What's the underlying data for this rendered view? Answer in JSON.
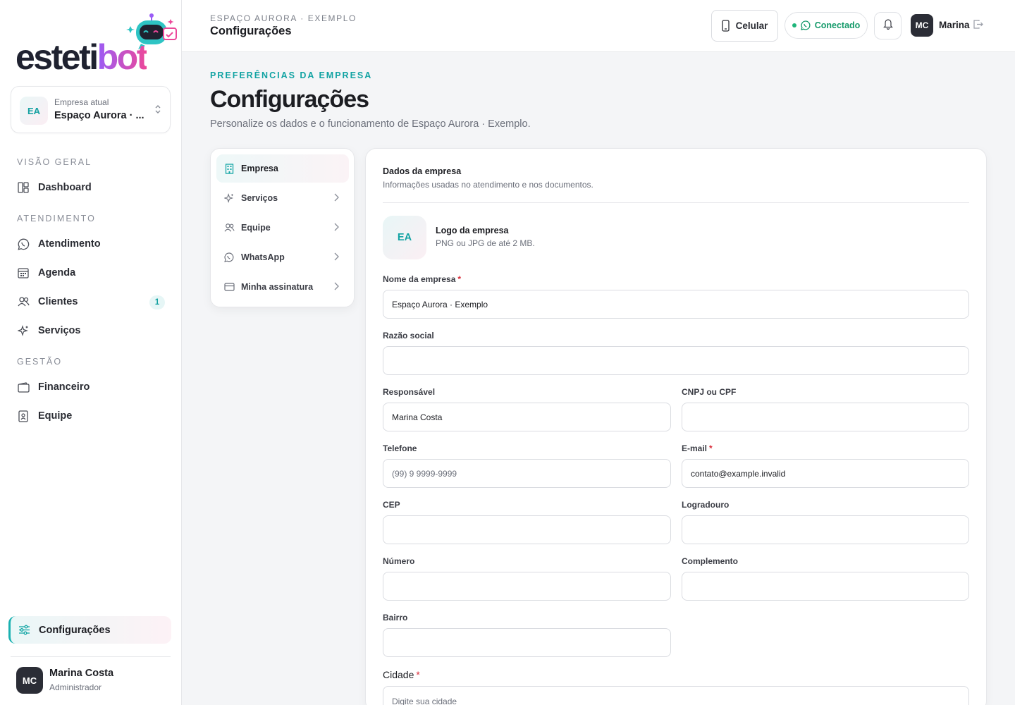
{
  "brand": {
    "logo_text_1": "esteti",
    "logo_text_2": "bot"
  },
  "sidebar": {
    "company_card": {
      "initials": "EA",
      "label": "Empresa atual",
      "name": "Espaço Aurora · ..."
    },
    "sections": [
      {
        "title": "VISÃO GERAL",
        "items": [
          {
            "label": "Dashboard",
            "icon": "dashboard-icon"
          }
        ]
      },
      {
        "title": "ATENDIMENTO",
        "items": [
          {
            "label": "Atendimento",
            "icon": "whatsapp-icon"
          },
          {
            "label": "Agenda",
            "icon": "calendar-icon"
          },
          {
            "label": "Clientes",
            "icon": "users-icon",
            "badge": "1"
          },
          {
            "label": "Serviços",
            "icon": "sparkles-icon"
          }
        ]
      },
      {
        "title": "GESTÃO",
        "items": [
          {
            "label": "Financeiro",
            "icon": "wallet-icon"
          },
          {
            "label": "Equipe",
            "icon": "badge-icon"
          }
        ]
      }
    ],
    "active_item": {
      "label": "Configurações",
      "icon": "sliders-icon"
    },
    "user": {
      "initials": "MC",
      "name": "Marina Costa",
      "role": "Administrador"
    }
  },
  "topbar": {
    "breadcrumb": "ESPAÇO AURORA · EXEMPLO",
    "title": "Configurações",
    "phone_button": "Celular",
    "status": "Conectado",
    "user_initials": "MC",
    "user_name": "Marina"
  },
  "page": {
    "eyebrow": "PREFERÊNCIAS DA EMPRESA",
    "title": "Configurações",
    "description": "Personalize os dados e o funcionamento de Espaço Aurora · Exemplo."
  },
  "settings_menu": [
    {
      "label": "Empresa",
      "icon": "building-icon",
      "active": true
    },
    {
      "label": "Serviços",
      "icon": "sparkles-icon"
    },
    {
      "label": "Equipe",
      "icon": "users-icon"
    },
    {
      "label": "WhatsApp",
      "icon": "whatsapp-icon"
    },
    {
      "label": "Minha assinatura",
      "icon": "credit-card-icon"
    }
  ],
  "form": {
    "title": "Dados da empresa",
    "subtitle": "Informações usadas no atendimento e nos documentos.",
    "logo": {
      "initials": "EA",
      "title": "Logo da empresa",
      "hint": "PNG ou JPG de até 2 MB."
    },
    "fields": {
      "nome": {
        "label": "Nome da empresa",
        "required": "*",
        "value": "Espaço Aurora · Exemplo"
      },
      "razao": {
        "label": "Razão social",
        "value": ""
      },
      "responsavel": {
        "label": "Responsável",
        "value": "Marina Costa"
      },
      "cnpj": {
        "label": "CNPJ ou CPF",
        "value": ""
      },
      "telefone": {
        "label": "Telefone",
        "placeholder": "(99) 9 9999-9999",
        "value": ""
      },
      "email": {
        "label": "E-mail",
        "required": "*",
        "value": "contato@example.invalid"
      },
      "cep": {
        "label": "CEP",
        "value": ""
      },
      "logradouro": {
        "label": "Logradouro",
        "value": ""
      },
      "numero": {
        "label": "Número",
        "value": ""
      },
      "complemento": {
        "label": "Complemento",
        "value": ""
      },
      "bairro": {
        "label": "Bairro",
        "value": ""
      },
      "cidade": {
        "label": "Cidade",
        "required": "*",
        "placeholder": "Digite sua cidade",
        "value": ""
      }
    }
  },
  "colors": {
    "accent": "#12a3a3",
    "success": "#159a6a",
    "required": "#d92d3a",
    "dark": "#2b2d36"
  }
}
